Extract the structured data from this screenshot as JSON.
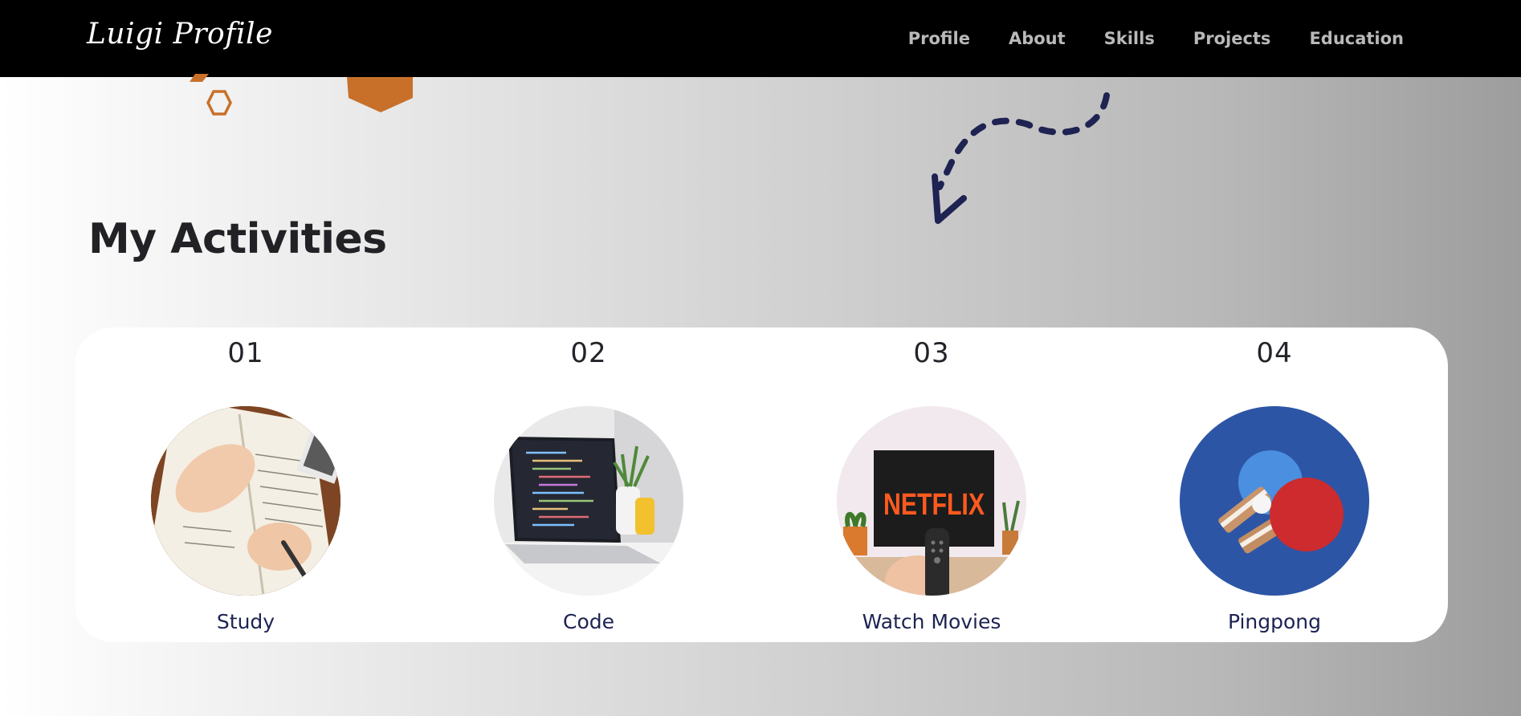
{
  "nav": {
    "brand": "Luigi Profile",
    "links": [
      "Profile",
      "About",
      "Skills",
      "Projects",
      "Education"
    ]
  },
  "colors": {
    "nav_bg": "#000000",
    "nav_link": "#b9b9b9",
    "hex_orange": "#c8702a",
    "arrow_navy": "#1e2352",
    "label_navy": "#1d2352"
  },
  "activities": {
    "title": "My Activities",
    "items": [
      {
        "number": "01",
        "label": "Study",
        "image_icon": "study-notebook-image"
      },
      {
        "number": "02",
        "label": "Code",
        "image_icon": "laptop-code-image"
      },
      {
        "number": "03",
        "label": "Watch Movies",
        "image_icon": "netflix-tv-image",
        "tv_text": "NETFLIX"
      },
      {
        "number": "04",
        "label": "Pingpong",
        "image_icon": "pingpong-paddles-image"
      }
    ]
  }
}
